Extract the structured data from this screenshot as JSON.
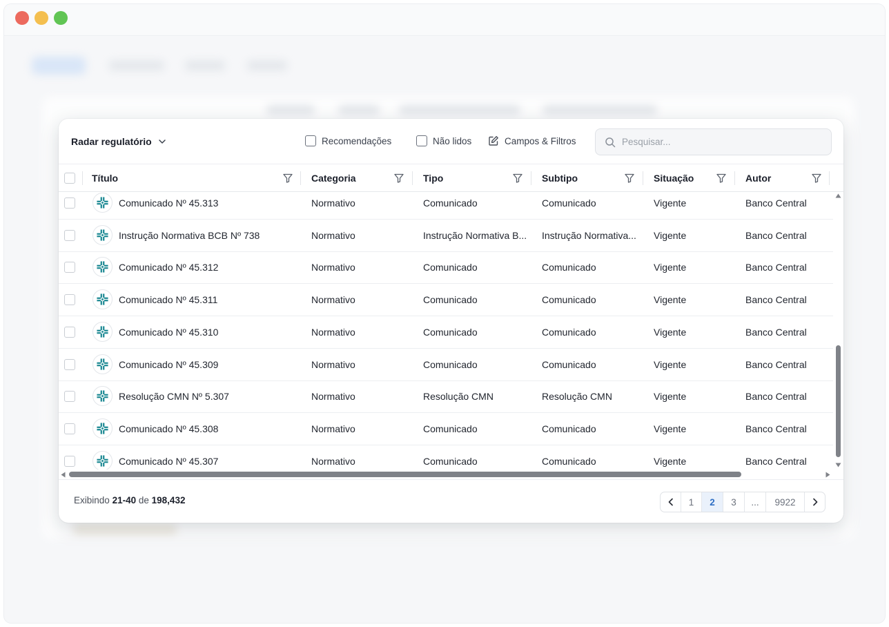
{
  "toolbar": {
    "view_label": "Radar regulatório",
    "recommendations_label": "Recomendações",
    "unread_label": "Não lidos",
    "fields_filters_label": "Campos & Filtros",
    "search_placeholder": "Pesquisar..."
  },
  "table": {
    "headers": [
      "Título",
      "Categoria",
      "Tipo",
      "Subtipo",
      "Situação",
      "Autor"
    ],
    "rows": [
      [
        "Comunicado Nº 45.313",
        "Normativo",
        "Comunicado",
        "Comunicado",
        "Vigente",
        "Banco Central"
      ],
      [
        "Instrução Normativa BCB Nº 738",
        "Normativo",
        "Instrução Normativa B...",
        "Instrução Normativa...",
        "Vigente",
        "Banco Central"
      ],
      [
        "Comunicado Nº 45.312",
        "Normativo",
        "Comunicado",
        "Comunicado",
        "Vigente",
        "Banco Central"
      ],
      [
        "Comunicado Nº 45.311",
        "Normativo",
        "Comunicado",
        "Comunicado",
        "Vigente",
        "Banco Central"
      ],
      [
        "Comunicado Nº 45.310",
        "Normativo",
        "Comunicado",
        "Comunicado",
        "Vigente",
        "Banco Central"
      ],
      [
        "Comunicado Nº 45.309",
        "Normativo",
        "Comunicado",
        "Comunicado",
        "Vigente",
        "Banco Central"
      ],
      [
        "Resolução CMN Nº 5.307",
        "Normativo",
        "Resolução CMN",
        "Resolução CMN",
        "Vigente",
        "Banco Central"
      ],
      [
        "Comunicado Nº 45.308",
        "Normativo",
        "Comunicado",
        "Comunicado",
        "Vigente",
        "Banco Central"
      ],
      [
        "Comunicado Nº 45.307",
        "Normativo",
        "Comunicado",
        "Comunicado",
        "Vigente",
        "Banco Central"
      ]
    ],
    "row_icon": "banco-central-logo-icon"
  },
  "footer": {
    "showing_prefix": "Exibindo",
    "range": "21-40",
    "of_label": "de",
    "total": "198,432"
  },
  "pagination": {
    "pages": [
      "1",
      "2",
      "3",
      "...",
      "9922"
    ],
    "current": "2"
  },
  "colors": {
    "accent": "#2f6fc4",
    "logo_teal": "#1f8a94",
    "window_red": "#ec6a5e",
    "window_yellow": "#f4bf4f",
    "window_green": "#61c554"
  }
}
